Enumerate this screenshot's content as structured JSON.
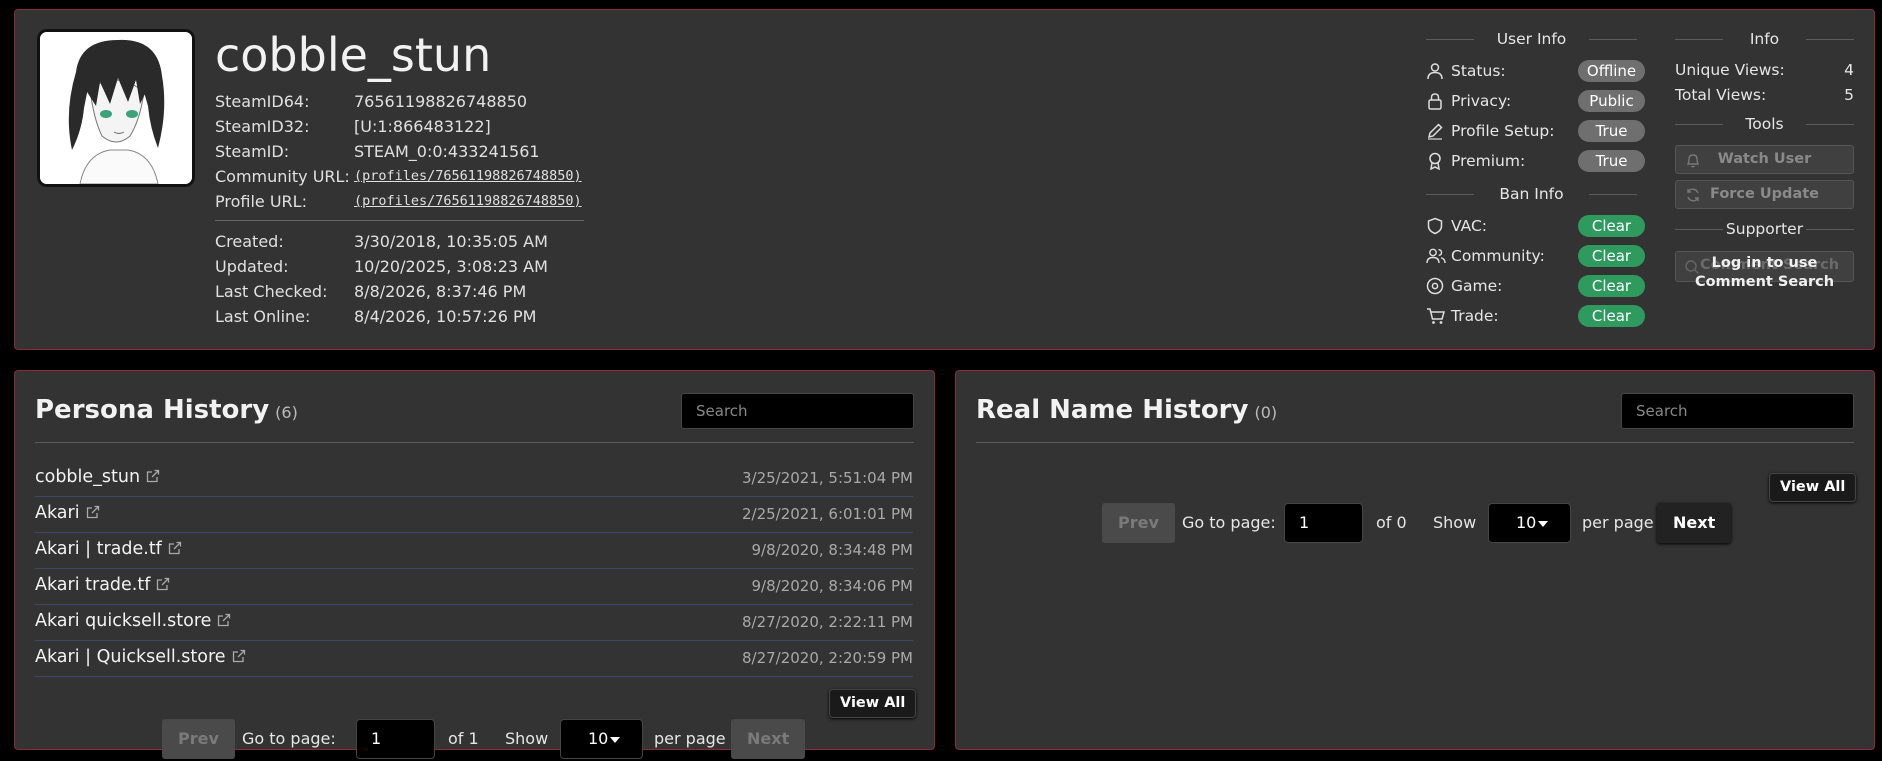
{
  "profile": {
    "username": "cobble_stun",
    "ids": [
      {
        "label": "SteamID64:",
        "value": "76561198826748850"
      },
      {
        "label": "SteamID32:",
        "value": "[U:1:866483122]"
      },
      {
        "label": "SteamID:",
        "value": "STEAM_0:0:433241561"
      },
      {
        "label": "Community URL:",
        "value": "(profiles/76561198826748850)"
      },
      {
        "label": "Profile URL:",
        "value": "(profiles/76561198826748850)"
      }
    ],
    "dates": [
      {
        "label": "Created:",
        "value": "3/30/2018, 10:35:05 AM"
      },
      {
        "label": "Updated:",
        "value": "10/20/2025, 3:08:23 AM"
      },
      {
        "label": "Last Checked:",
        "value": "8/8/2026, 8:37:46 PM"
      },
      {
        "label": "Last Online:",
        "value": "8/4/2026, 10:57:26 PM"
      }
    ]
  },
  "user_info": {
    "title": "User Info",
    "rows": [
      {
        "label": "Status:",
        "value": "Offline",
        "icon": "user-icon"
      },
      {
        "label": "Privacy:",
        "value": "Public",
        "icon": "lock-icon"
      },
      {
        "label": "Profile Setup:",
        "value": "True",
        "icon": "pencil-icon"
      },
      {
        "label": "Premium:",
        "value": "True",
        "icon": "award-icon"
      }
    ]
  },
  "ban_info": {
    "title": "Ban Info",
    "rows": [
      {
        "label": "VAC:",
        "value": "Clear",
        "icon": "shield-icon"
      },
      {
        "label": "Community:",
        "value": "Clear",
        "icon": "users-icon"
      },
      {
        "label": "Game:",
        "value": "Clear",
        "icon": "disc-icon"
      },
      {
        "label": "Trade:",
        "value": "Clear",
        "icon": "cart-icon"
      }
    ]
  },
  "info": {
    "title": "Info",
    "unique_views_label": "Unique Views:",
    "unique_views": "4",
    "total_views_label": "Total Views:",
    "total_views": "5"
  },
  "tools": {
    "title": "Tools",
    "watch_label": "Watch User",
    "force_label": "Force Update"
  },
  "supporter": {
    "title": "Supporter",
    "button_label": "Comment Search",
    "overlay_text": "Log in to use Comment Search"
  },
  "persona": {
    "title": "Persona History",
    "count": "(6)",
    "search_placeholder": "Search",
    "rows": [
      {
        "name": "cobble_stun",
        "date": "3/25/2021, 5:51:04 PM"
      },
      {
        "name": "Akari",
        "date": "2/25/2021, 6:01:01 PM"
      },
      {
        "name": "Akari | trade.tf",
        "date": "9/8/2020, 8:34:48 PM"
      },
      {
        "name": "Akari trade.tf",
        "date": "9/8/2020, 8:34:06 PM"
      },
      {
        "name": "Akari quicksell.store",
        "date": "8/27/2020, 2:22:11 PM"
      },
      {
        "name": "Akari | Quicksell.store",
        "date": "8/27/2020, 2:20:59 PM"
      }
    ],
    "view_all": "View All",
    "pager": {
      "prev": "Prev",
      "goto": "Go to page:",
      "page": "1",
      "of": "of 1",
      "show": "Show",
      "per_page_value": "10",
      "per_page": "per page",
      "next": "Next"
    }
  },
  "realname": {
    "title": "Real Name History",
    "count": "(0)",
    "search_placeholder": "Search",
    "view_all": "View All",
    "pager": {
      "prev": "Prev",
      "goto": "Go to page:",
      "page": "1",
      "of": "of 0",
      "show": "Show",
      "per_page_value": "10",
      "per_page": "per page",
      "next": "Next"
    }
  }
}
